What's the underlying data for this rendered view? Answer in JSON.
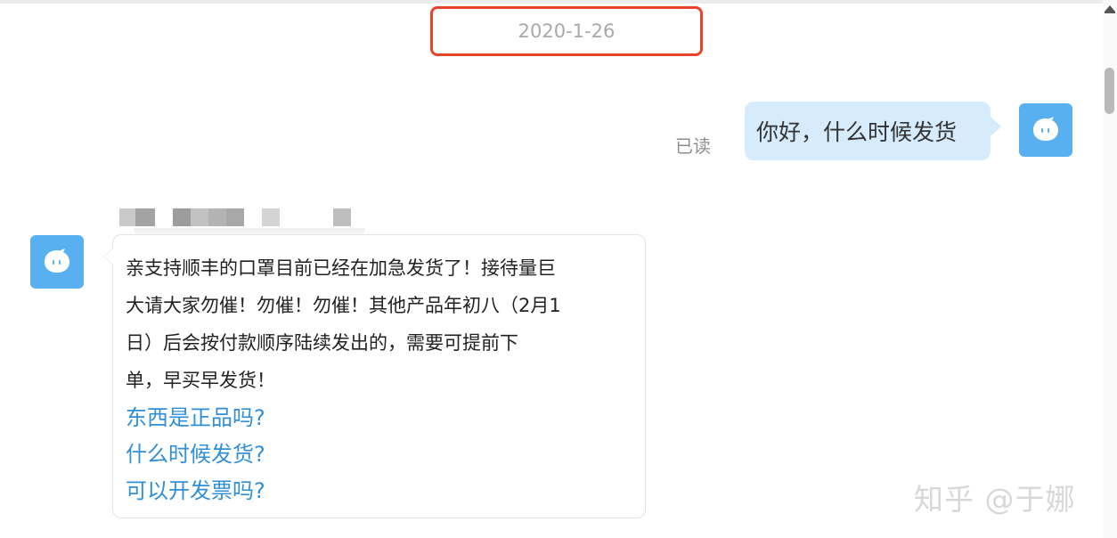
{
  "chat": {
    "date_divider": "2020-1-26",
    "outgoing": {
      "text": "你好，什么时候发货",
      "read_status": "已读"
    },
    "incoming": {
      "message_lines": [
        "亲支持顺丰的口罩目前已经在加急发货了！接待量巨",
        "大请大家勿催！勿催！勿催！其他产品年初八（2月1",
        "日）后会按付款顺序陆续发出的，需要可提前下",
        "单，早买早发货！"
      ],
      "quick_questions": [
        "东西是正品吗?",
        "什么时候发货?",
        "可以开发票吗?"
      ]
    }
  },
  "watermark": "知乎 @于娜",
  "colors": {
    "highlight_border": "#e8432b",
    "avatar_bg": "#59b0f1",
    "outgoing_bubble": "#d6ebfb",
    "link": "#2f8fd8"
  },
  "icons": {
    "avatar": "chat-bot-icon",
    "scroll_up": "arrow-up-icon"
  }
}
